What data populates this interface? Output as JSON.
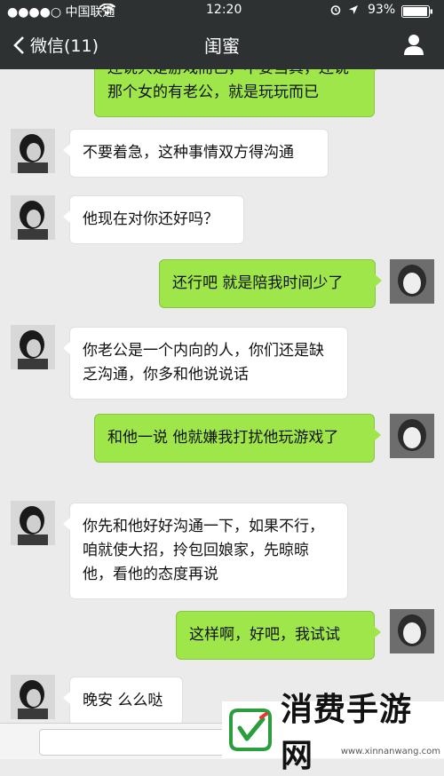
{
  "status_bar": {
    "carrier": "●●●●○ 中国联通",
    "time": "12:20",
    "battery": "93%"
  },
  "nav": {
    "back_label": "微信(11)",
    "title": "闺蜜"
  },
  "messages": [
    {
      "side": "out",
      "text": "还说只是游戏而已，不要当真，还说那个女的有老公，就是玩玩而已"
    },
    {
      "side": "in",
      "text": "不要着急，这种事情双方得沟通"
    },
    {
      "side": "in",
      "text": "他现在对你还好吗？"
    },
    {
      "side": "out",
      "text": "还行吧 就是陪我时间少了"
    },
    {
      "side": "in",
      "text": "你老公是一个内向的人，你们还是缺乏沟通，你多和他说说话"
    },
    {
      "side": "out",
      "text": "和他一说 他就嫌我打扰他玩游戏了"
    },
    {
      "side": "in",
      "text": "你先和他好好沟通一下，如果不行，咱就使大招，拎包回娘家，先晾晾他，看他的态度再说"
    },
    {
      "side": "out",
      "text": "这样啊，好吧，我试试"
    },
    {
      "side": "in",
      "text": "晚安 么么哒"
    }
  ],
  "watermark": {
    "name": "消费手游网",
    "url": "www.xinnanwang.com"
  },
  "colors": {
    "header_bg": "#2e3132",
    "chat_bg": "#ebebeb",
    "out_bubble": "#9ee64a",
    "in_bubble": "#ffffff",
    "brand_green": "#2a9d3c"
  }
}
